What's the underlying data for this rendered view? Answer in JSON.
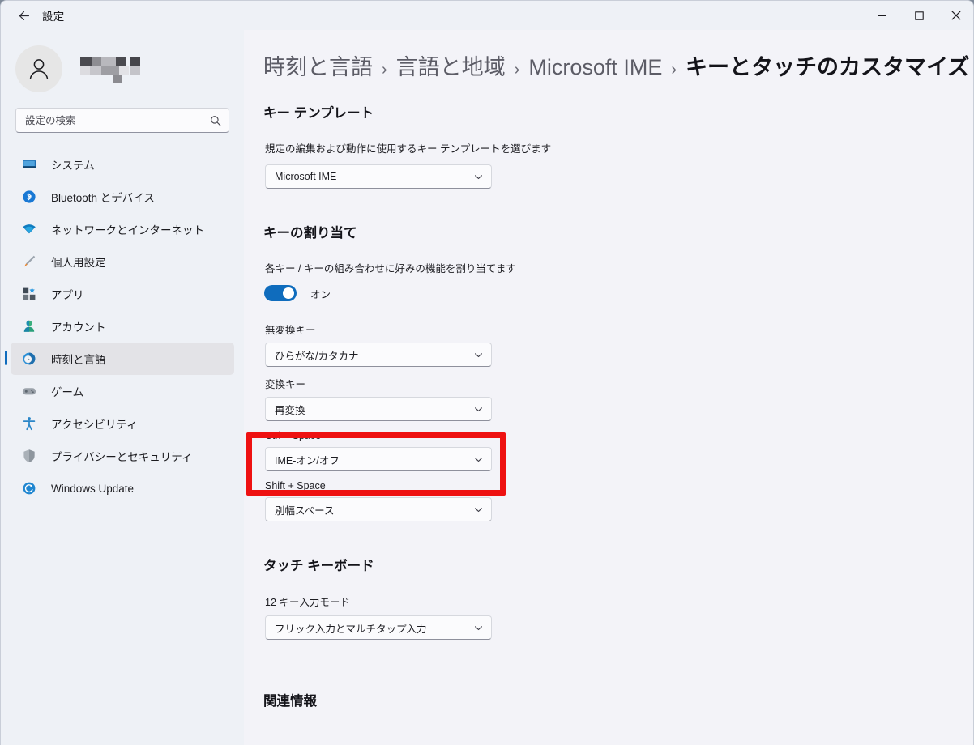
{
  "window": {
    "title": "設定",
    "back_icon": "back-arrow-icon",
    "controls": {
      "minimize": "minimize-icon",
      "maximize": "maximize-icon",
      "close": "close-icon"
    }
  },
  "sidebar": {
    "account": {
      "avatar_icon": "person-avatar-icon",
      "user_name_redacted": ""
    },
    "search": {
      "placeholder": "設定の検索",
      "value": "",
      "icon": "search-icon"
    },
    "items": [
      {
        "label": "システム",
        "icon": "monitor-icon",
        "selected": false
      },
      {
        "label": "Bluetooth とデバイス",
        "icon": "bluetooth-icon",
        "selected": false
      },
      {
        "label": "ネットワークとインターネット",
        "icon": "wifi-icon",
        "selected": false
      },
      {
        "label": "個人用設定",
        "icon": "paintbrush-icon",
        "selected": false
      },
      {
        "label": "アプリ",
        "icon": "apps-icon",
        "selected": false
      },
      {
        "label": "アカウント",
        "icon": "account-icon",
        "selected": false
      },
      {
        "label": "時刻と言語",
        "icon": "clock-globe-icon",
        "selected": true
      },
      {
        "label": "ゲーム",
        "icon": "gamepad-icon",
        "selected": false
      },
      {
        "label": "アクセシビリティ",
        "icon": "accessibility-icon",
        "selected": false
      },
      {
        "label": "プライバシーとセキュリティ",
        "icon": "shield-icon",
        "selected": false
      },
      {
        "label": "Windows Update",
        "icon": "update-icon",
        "selected": false
      }
    ]
  },
  "breadcrumb": {
    "items": [
      "時刻と言語",
      "言語と地域",
      "Microsoft IME"
    ],
    "current": "キーとタッチのカスタマイズ",
    "separator": "›"
  },
  "main": {
    "sections": [
      {
        "title": "キー テンプレート",
        "description": "規定の編集および動作に使用するキー テンプレートを選びます",
        "combo_value": "Microsoft IME"
      },
      {
        "title": "キーの割り当て",
        "description": "各キー / キーの組み合わせに好みの機能を割り当てます",
        "toggle_state": "オン",
        "toggle_on": true
      },
      {
        "title": "タッチ キーボード",
        "field_label": "12 キー入力モード",
        "combo_value": "フリック入力とマルチタップ入力"
      }
    ],
    "key_assignments": [
      {
        "label": "無変換キー",
        "value": "ひらがな/カタカナ",
        "highlighted": false
      },
      {
        "label": "変換キー",
        "value": "再変換",
        "highlighted": false
      },
      {
        "label": "Ctrl + Space",
        "value": "IME-オン/オフ",
        "highlighted": true
      },
      {
        "label": "Shift + Space",
        "value": "別幅スペース",
        "highlighted": false
      }
    ],
    "footer_section_title": "関連情報"
  },
  "colors": {
    "accent": "#0f6cbd",
    "highlight_box": "#ee1111",
    "content_bg": "#f3f3f8",
    "sidebar_bg": "#eef1f6"
  }
}
